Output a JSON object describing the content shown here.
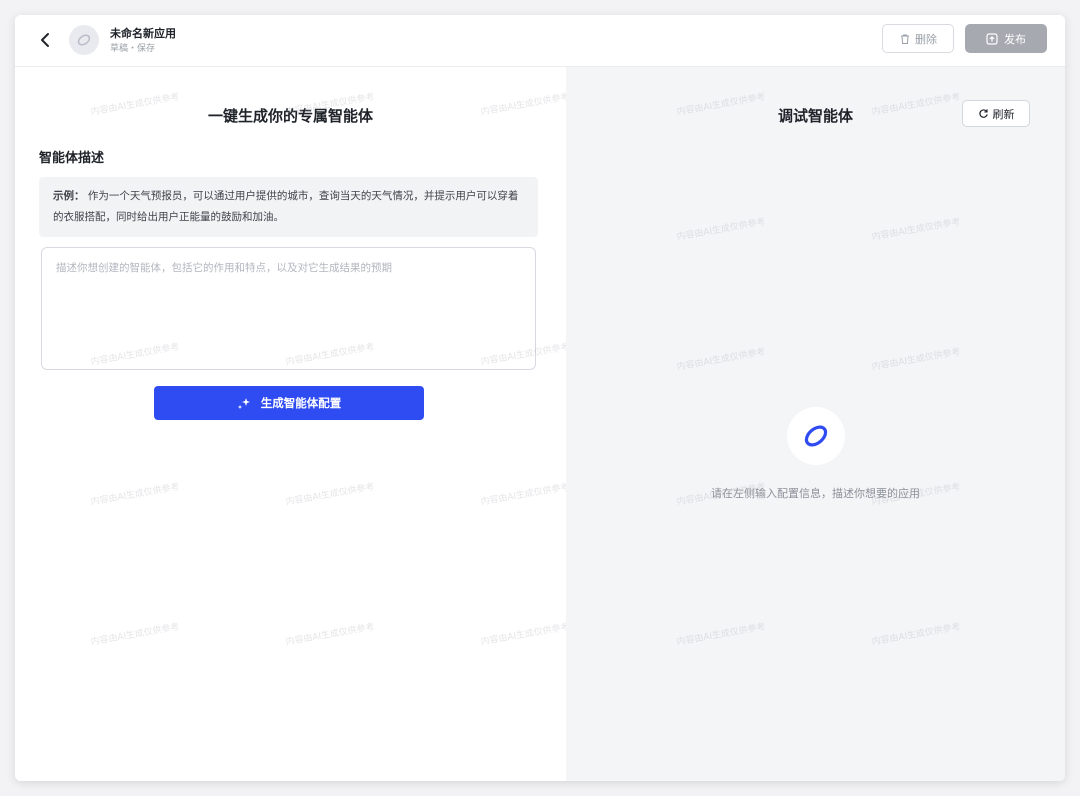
{
  "header": {
    "app_name": "未命名新应用",
    "app_status": "草稿・保存",
    "delete_label": "删除",
    "publish_label": "发布"
  },
  "left": {
    "title": "一键生成你的专属智能体",
    "desc_label": "智能体描述",
    "example_prefix": "示例：",
    "example_text": "作为一个天气预报员，可以通过用户提供的城市，查询当天的天气情况，并提示用户可以穿着的衣服搭配，同时给出用户正能量的鼓励和加油。",
    "textarea_placeholder": "描述你想创建的智能体，包括它的作用和特点，以及对它生成结果的预期",
    "generate_label": "生成智能体配置"
  },
  "right": {
    "title": "调试智能体",
    "refresh_label": "刷新",
    "hint": "请在左侧输入配置信息，描述你想要的应用"
  },
  "colors": {
    "primary": "#2f4bf2",
    "publish_disabled": "#a6a9b0",
    "panel_bg": "#f4f5f7"
  }
}
